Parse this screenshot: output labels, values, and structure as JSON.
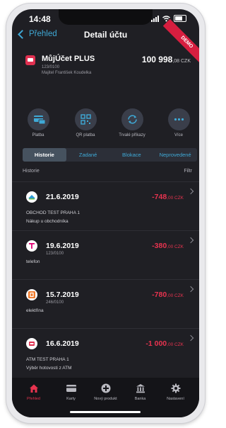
{
  "status": {
    "time": "14:48"
  },
  "nav": {
    "back_label": "Přehled",
    "title": "Detail účtu",
    "badge": "DEMO"
  },
  "account": {
    "name": "MůjÚčet PLUS",
    "number": "123/0100",
    "owner": "Majitel František Koudelka",
    "balance": "100 998",
    "balance_suffix": ",08 CZK"
  },
  "actions": [
    {
      "label": "Platba",
      "icon": "card-payment-icon"
    },
    {
      "label": "QR platba",
      "icon": "qr-code-icon"
    },
    {
      "label": "Trvalé příkazy",
      "icon": "repeat-icon"
    },
    {
      "label": "Více",
      "icon": "more-dots-icon"
    }
  ],
  "tabs": [
    {
      "label": "Historie",
      "active": true
    },
    {
      "label": "Zadané",
      "active": false
    },
    {
      "label": "Blokace",
      "active": false
    },
    {
      "label": "Neprovedené",
      "active": false
    }
  ],
  "history": {
    "title": "Historie",
    "filter_label": "Filtr"
  },
  "transactions": [
    {
      "date": "21.6.2019",
      "account": "",
      "desc1": "OBCHOD TEST PRAHA 1",
      "desc2": "Nákup u obchodníka",
      "amount": "-748",
      "amount_suffix": ",00 CZK",
      "icon": "shop-icon",
      "icon_color": "#2f9bd6"
    },
    {
      "date": "19.6.2019",
      "account": "123/0100",
      "desc1": "telefon",
      "desc2": "",
      "amount": "-380",
      "amount_suffix": ",00 CZK",
      "icon": "telekom-icon",
      "icon_color": "#e20074"
    },
    {
      "date": "15.7.2019",
      "account": "246/0100",
      "desc1": "elektřina",
      "desc2": "",
      "amount": "-780",
      "amount_suffix": ",00 CZK",
      "icon": "energy-icon",
      "icon_color": "#f07a2a"
    },
    {
      "date": "16.6.2019",
      "account": "",
      "desc1": "ATM TEST PRAHA 1",
      "desc2": "Výběr hotovosti z ATM",
      "amount": "-1 000",
      "amount_suffix": ",00 CZK",
      "icon": "atm-icon",
      "icon_color": "#e03050"
    }
  ],
  "tabbar": [
    {
      "label": "Přehled",
      "icon": "home-icon",
      "active": true
    },
    {
      "label": "Karty",
      "icon": "card-icon",
      "active": false
    },
    {
      "label": "Nový produkt",
      "icon": "plus-circle-icon",
      "active": false
    },
    {
      "label": "Banka",
      "icon": "bank-icon",
      "active": false
    },
    {
      "label": "Nastavení",
      "icon": "gear-icon",
      "active": false
    }
  ],
  "colors": {
    "accent": "#3fa9d6",
    "negative": "#e8334f",
    "background": "#1f1f24"
  }
}
